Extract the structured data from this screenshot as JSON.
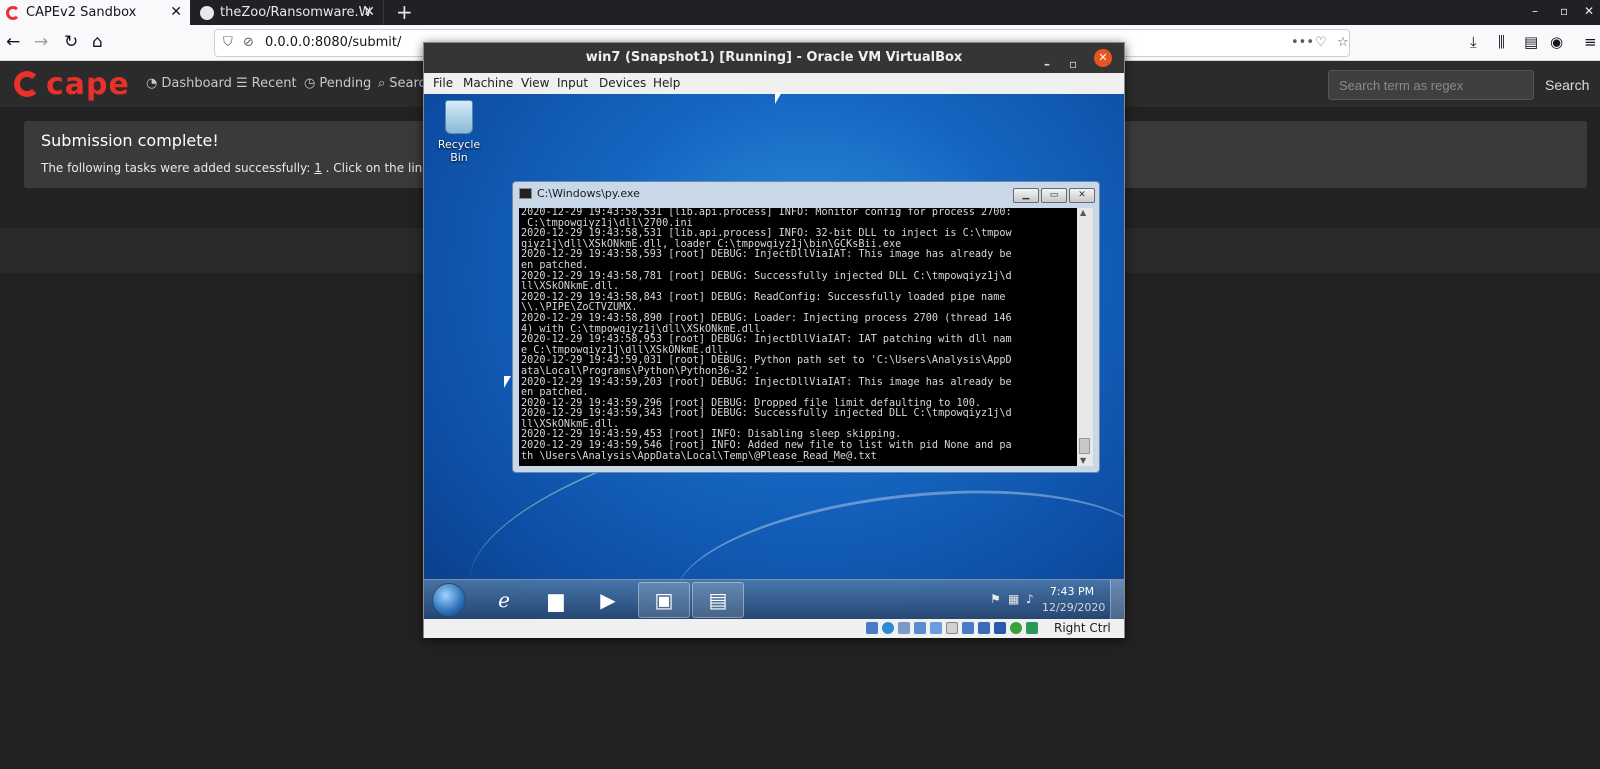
{
  "browser": {
    "tabs": [
      {
        "title": "CAPEv2 Sandbox",
        "active": true
      },
      {
        "title": "theZoo/Ransomware.Wa",
        "active": false
      }
    ],
    "new_tab_label": "+",
    "url": "0.0.0.0:8080/submit/",
    "window_controls": {
      "minimize": "–",
      "restore": "▫",
      "close": "✕"
    }
  },
  "cape": {
    "logo_text": "cape",
    "nav": [
      {
        "icon": "dashboard-icon",
        "label": "Dashboard"
      },
      {
        "icon": "list-icon",
        "label": "Recent"
      },
      {
        "icon": "clock-icon",
        "label": "Pending"
      },
      {
        "icon": "search-icon",
        "label": "Searc"
      }
    ],
    "search_placeholder": "Search term as regex",
    "search_button": "Search",
    "alert": {
      "title": "Submission complete!",
      "text_before": "The following tasks were added successfully: ",
      "task_link": "1",
      "text_after": " . Click on the links to m"
    }
  },
  "vbox": {
    "title": "win7 (Snapshot1) [Running] - Oracle VM VirtualBox",
    "menu": [
      "File",
      "Machine",
      "View",
      "Input",
      "Devices",
      "Help"
    ],
    "status_host_key": "Right Ctrl"
  },
  "guest": {
    "recycle_bin": "Recycle Bin",
    "console": {
      "title": "C:\\Windows\\py.exe",
      "lines": [
        "2020-12-29 19:43:58,531 [lib.api.process] INFO: Monitor config for process 2700:",
        " C:\\tmpowqiyz1j\\dll\\2700.ini",
        "2020-12-29 19:43:58,531 [lib.api.process] INFO: 32-bit DLL to inject is C:\\tmpow",
        "qiyz1j\\dll\\XSkONkmE.dll, loader C:\\tmpowqiyz1j\\bin\\GCKsBii.exe",
        "2020-12-29 19:43:58,593 [root] DEBUG: InjectDllViaIAT: This image has already be",
        "en patched.",
        "2020-12-29 19:43:58,781 [root] DEBUG: Successfully injected DLL C:\\tmpowqiyz1j\\d",
        "ll\\XSkONkmE.dll.",
        "2020-12-29 19:43:58,843 [root] DEBUG: ReadConfig: Successfully loaded pipe name",
        "\\\\.\\PIPE\\ZoCTVZUMX.",
        "2020-12-29 19:43:58,890 [root] DEBUG: Loader: Injecting process 2700 (thread 146",
        "4) with C:\\tmpowqiyz1j\\dll\\XSkONkmE.dll.",
        "2020-12-29 19:43:58,953 [root] DEBUG: InjectDllViaIAT: IAT patching with dll nam",
        "e C:\\tmpowqiyz1j\\dll\\XSkONkmE.dll.",
        "2020-12-29 19:43:59,031 [root] DEBUG: Python path set to 'C:\\Users\\Analysis\\AppD",
        "ata\\Local\\Programs\\Python\\Python36-32'.",
        "2020-12-29 19:43:59,203 [root] DEBUG: InjectDllViaIAT: This image has already be",
        "en patched.",
        "2020-12-29 19:43:59,296 [root] DEBUG: Dropped file limit defaulting to 100.",
        "2020-12-29 19:43:59,343 [root] DEBUG: Successfully injected DLL C:\\tmpowqiyz1j\\d",
        "ll\\XSkONkmE.dll.",
        "2020-12-29 19:43:59,453 [root] INFO: Disabling sleep skipping.",
        "2020-12-29 19:43:59,546 [root] INFO: Added new file to list with pid None and pa",
        "th \\Users\\Analysis\\AppData\\Local\\Temp\\@Please_Read_Me@.txt"
      ]
    },
    "clock_time": "7:43 PM",
    "clock_date": "12/29/2020"
  },
  "colors": {
    "cape_red": "#e8312b",
    "page_bg": "#222222",
    "vbox_close": "#e95420"
  }
}
